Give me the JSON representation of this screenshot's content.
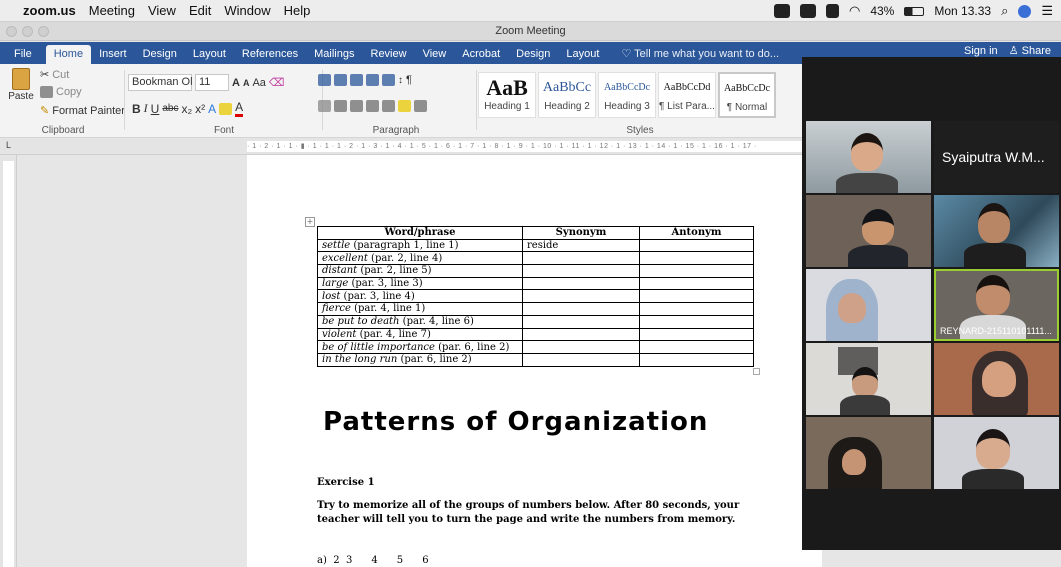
{
  "menubar": {
    "app": "zoom.us",
    "items": [
      "Meeting",
      "View",
      "Edit",
      "Window",
      "Help"
    ],
    "battery": "43%",
    "clock": "Mon 13.33"
  },
  "window": {
    "title": "Zoom Meeting"
  },
  "ribbon": {
    "tabs": [
      "File",
      "Home",
      "Insert",
      "Design",
      "Layout",
      "References",
      "Mailings",
      "Review",
      "View",
      "Acrobat",
      "Design",
      "Layout"
    ],
    "active_tab": "Home",
    "tell_me": "Tell me what you want to do...",
    "sign_in": "Sign in",
    "share": "Share",
    "clipboard": {
      "paste": "Paste",
      "cut": "Cut",
      "copy": "Copy",
      "format_painter": "Format Painter",
      "label": "Clipboard"
    },
    "font": {
      "name": "Bookman Ol",
      "size": "11",
      "label": "Font"
    },
    "paragraph": {
      "label": "Paragraph"
    },
    "styles": {
      "label": "Styles",
      "items": [
        {
          "preview": "AaB",
          "name": "Heading 1"
        },
        {
          "preview": "AaBbCc",
          "name": "Heading 2"
        },
        {
          "preview": "AaBbCcDc",
          "name": "Heading 3"
        },
        {
          "preview": "AaBbCcDd",
          "name": "¶ List Para..."
        },
        {
          "preview": "AaBbCcDc",
          "name": "¶ Normal"
        }
      ]
    }
  },
  "document": {
    "table": {
      "headers": [
        "Word/phrase",
        "Synonym",
        "Antonym"
      ],
      "rows": [
        {
          "term": "settle",
          "ref": " (paragraph 1, line 1)",
          "synonym": "reside",
          "antonym": ""
        },
        {
          "term": "excellent",
          "ref": " (par. 2, line 4)",
          "synonym": "",
          "antonym": ""
        },
        {
          "term": "distant",
          "ref": " (par. 2, line 5)",
          "synonym": "",
          "antonym": ""
        },
        {
          "term": "large",
          "ref": " (par. 3, line 3)",
          "synonym": "",
          "antonym": ""
        },
        {
          "term": "lost",
          "ref": " (par. 3, line 4)",
          "synonym": "",
          "antonym": ""
        },
        {
          "term": "fierce",
          "ref": " (par. 4, line 1)",
          "synonym": "",
          "antonym": ""
        },
        {
          "term": "be put to death",
          "ref": " (par. 4, line 6)",
          "synonym": "",
          "antonym": ""
        },
        {
          "term": "violent",
          "ref": " (par. 4, line 7)",
          "synonym": "",
          "antonym": ""
        },
        {
          "term": "be of little importance",
          "ref": " (par. 6, line 2)",
          "synonym": "",
          "antonym": ""
        },
        {
          "term": "in the long run",
          "ref": " (par. 6, line 2)",
          "synonym": "",
          "antonym": ""
        }
      ]
    },
    "heading": "Patterns of Organization",
    "exercise_title": "Exercise 1",
    "instructions": "Try to memorize all of the groups of numbers below. After 80 seconds, your teacher will tell you to turn the page and write the numbers from memory.",
    "numbers_line": "a)  2  3      4      5      6"
  },
  "zoom": {
    "participants": [
      {
        "name": "",
        "video": true
      },
      {
        "name": "Syaiputra W.M...",
        "video": false
      },
      {
        "name": "",
        "video": true
      },
      {
        "name": "",
        "video": true
      },
      {
        "name": "",
        "video": true
      },
      {
        "name": "REYNARD-215110101111...",
        "video": true,
        "speaking": true
      },
      {
        "name": "",
        "video": true
      },
      {
        "name": "",
        "video": true
      },
      {
        "name": "",
        "video": true
      },
      {
        "name": "",
        "video": true
      }
    ]
  }
}
